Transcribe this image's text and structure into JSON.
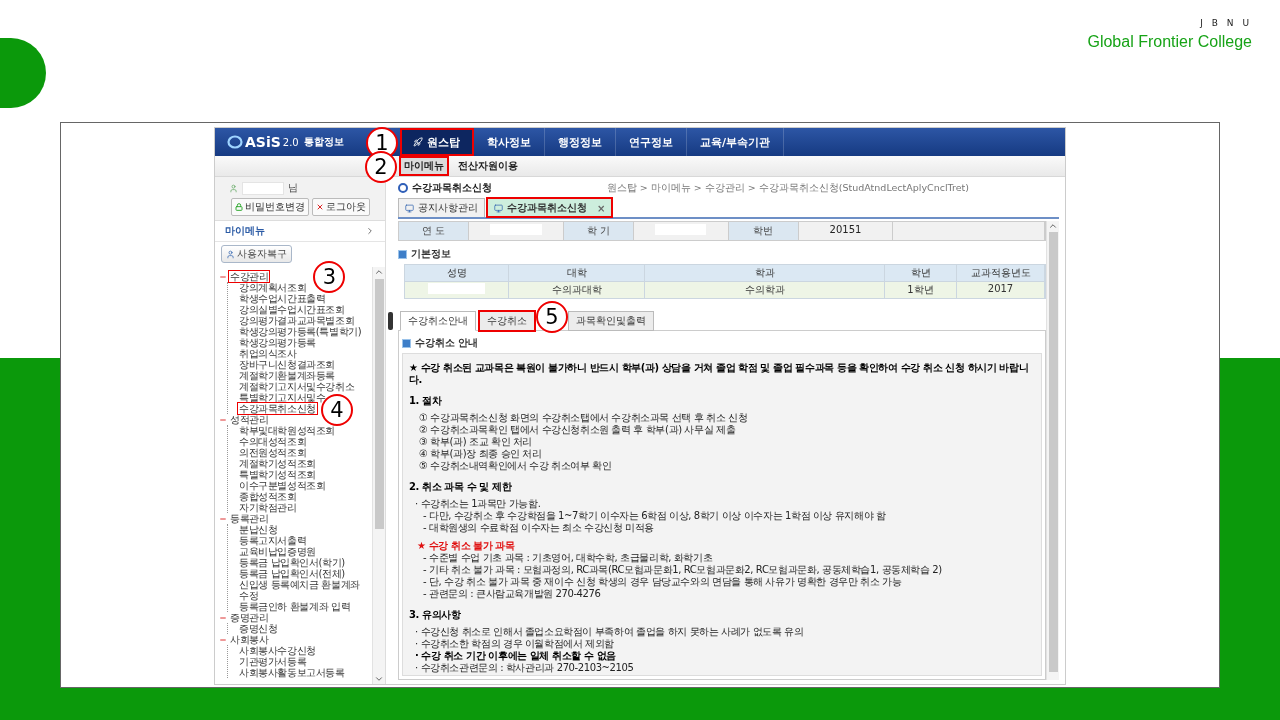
{
  "slide": {
    "org": "J B N U",
    "college": "Global Frontier College"
  },
  "app": {
    "logo": {
      "name": "ASiS",
      "version": "2.0",
      "title": "통합정보"
    },
    "top_nav": [
      {
        "label": "원스탑",
        "selected": true,
        "highlighted": true,
        "callout": "1"
      },
      {
        "label": "학사정보",
        "selected": false,
        "highlighted": false
      },
      {
        "label": "행정정보",
        "selected": false,
        "highlighted": false
      },
      {
        "label": "연구정보",
        "selected": false,
        "highlighted": false
      },
      {
        "label": "교육/부속기관",
        "selected": false,
        "highlighted": false
      }
    ],
    "sub_nav": [
      {
        "label": "마이메뉴",
        "selected": true,
        "highlighted": true,
        "callout": "2"
      },
      {
        "label": "전산자원이용",
        "selected": false,
        "highlighted": false
      }
    ],
    "user": {
      "suffix": "님",
      "buttons": [
        {
          "kind": "password",
          "label": "비밀번호변경"
        },
        {
          "kind": "logout",
          "label": "로그아웃"
        }
      ]
    },
    "my_menu": "마이메뉴",
    "restore_button": "사용자복구",
    "tree": [
      {
        "label": "수강관리",
        "expanded": true,
        "highlighted": true,
        "callout": "3",
        "children": [
          {
            "label": "강의계획서조회",
            "highlighted": false
          },
          {
            "label": "학생수업시간표출력",
            "highlighted": false
          },
          {
            "label": "강의실별수업시간표조회",
            "highlighted": false
          },
          {
            "label": "강의평가결과교과목별조회",
            "highlighted": false
          },
          {
            "label": "학생강의평가등록(특별학기)",
            "highlighted": false
          },
          {
            "label": "학생강의평가등록",
            "highlighted": false
          },
          {
            "label": "취업의식조사",
            "highlighted": false
          },
          {
            "label": "장바구니신청결과조회",
            "highlighted": false
          },
          {
            "label": "계절학기환불계좌등록",
            "highlighted": false
          },
          {
            "label": "계절학기고지서및수강취소",
            "highlighted": false
          },
          {
            "label": "특별학기고지서및수",
            "highlighted": false
          },
          {
            "label": "수강과목취소신청",
            "highlighted": true,
            "callout": "4"
          }
        ]
      },
      {
        "label": "성적관리",
        "expanded": true,
        "highlighted": false,
        "children": [
          {
            "label": "학부및대학원성적조회",
            "highlighted": false
          },
          {
            "label": "수의대성적조회",
            "highlighted": false
          },
          {
            "label": "의전원성적조회",
            "highlighted": false
          },
          {
            "label": "계절학기성적조회",
            "highlighted": false
          },
          {
            "label": "특별학기성적조회",
            "highlighted": false
          },
          {
            "label": "이수구분별성적조회",
            "highlighted": false
          },
          {
            "label": "종합성적조회",
            "highlighted": false
          },
          {
            "label": "자기학점관리",
            "highlighted": false
          }
        ]
      },
      {
        "label": "등록관리",
        "expanded": true,
        "highlighted": false,
        "children": [
          {
            "label": "분납신청",
            "highlighted": false
          },
          {
            "label": "등록고지서출력",
            "highlighted": false
          },
          {
            "label": "교육비납입증명원",
            "highlighted": false
          },
          {
            "label": "등록금 납입확인서(학기)",
            "highlighted": false
          },
          {
            "label": "등록금 납입확인서(전체)",
            "highlighted": false
          },
          {
            "label": "신입생 등록예치금 환불계좌 수정",
            "highlighted": false
          },
          {
            "label": "등록금인하 환불계좌 입력",
            "highlighted": false
          }
        ]
      },
      {
        "label": "증명관리",
        "expanded": true,
        "highlighted": false,
        "children": [
          {
            "label": "증명신청",
            "highlighted": false
          }
        ]
      },
      {
        "label": "사회봉사",
        "expanded": true,
        "highlighted": false,
        "children": [
          {
            "label": "사회봉사수강신청",
            "highlighted": false
          },
          {
            "label": "기관평가서등록",
            "highlighted": false
          },
          {
            "label": "사회봉사활동보고서등록",
            "highlighted": false
          }
        ]
      }
    ],
    "page": {
      "title": "수강과목취소신청",
      "breadcrumb": "원스탑 > 마이메뉴 > 수강관리 > 수강과목취소신청(StudAtndLectAplyCnclTret)",
      "doc_tabs": [
        {
          "label": "공지사항관리",
          "selected": false,
          "highlighted": false
        },
        {
          "label": "수강과목취소신청",
          "selected": true,
          "highlighted": true,
          "close": "×"
        }
      ],
      "term_row": [
        {
          "label": "연 도"
        },
        {
          "label": "학 기"
        },
        {
          "label": "학번",
          "value": "20151"
        }
      ],
      "basic_info": {
        "title": "기본정보",
        "columns": [
          "성명",
          "대학",
          "학과",
          "학년",
          "교과적용년도"
        ],
        "row": [
          "수의과대학",
          "수의학과",
          "1학년",
          "2017"
        ]
      },
      "inner_tabs": [
        {
          "label": "수강취소안내",
          "selected": true,
          "highlighted": false
        },
        {
          "label": "수강취소",
          "selected": false,
          "highlighted": true,
          "callout": "5"
        },
        {
          "label": "과목확인및출력",
          "selected": false,
          "highlighted": false
        }
      ],
      "guide": {
        "title": "수강취소 안내",
        "blocks": [
          {
            "kind": "notice",
            "text": "★ 수강 취소된 교과목은 복원이 불가하니 반드시 학부(과) 상담을 거쳐 졸업 학점 및 졸업 필수과목 등을 확인하여 수강 취소 신청 하시기 바랍니다."
          },
          {
            "kind": "heading",
            "text": "1. 절차"
          },
          {
            "kind": "item",
            "text": "① 수강과목취소신청 화면의 수강취소탭에서 수강취소과목 선택 후 취소 신청"
          },
          {
            "kind": "item",
            "text": "② 수강취소과목확인 탭에서 수강신청취소원 출력 후 학부(과) 사무실 제출"
          },
          {
            "kind": "item",
            "text": "③ 학부(과) 조교 확인 처리"
          },
          {
            "kind": "item",
            "text": "④ 학부(과)장 최종 승인 처리"
          },
          {
            "kind": "item",
            "text": "⑤ 수강취소내역확인에서 수강 취소여부 확인"
          },
          {
            "kind": "heading",
            "text": "2. 취소 과목 수 및 제한"
          },
          {
            "kind": "bullet",
            "text": "· 수강취소는 1과목만 가능함."
          },
          {
            "kind": "sub",
            "text": "- 다만, 수강취소 후 수강학점을 1~7학기 이수자는 6학점 이상, 8학기 이상 이수자는 1학점 이상  유지해야 함"
          },
          {
            "kind": "sub",
            "text": "- 대학원생의 수료학점 이수자는 최소 수강신청 미적용"
          },
          {
            "kind": "alert",
            "text": "★ 수강 취소 불가 과목"
          },
          {
            "kind": "sub",
            "text": "- 수준별 수업 기초 과목 : 기초영어, 대학수학, 초급물리학, 화학기초"
          },
          {
            "kind": "sub",
            "text": "- 기타 취소 불가 과목 :   모험과정의, RC과목(RC모험과문화1, RC모험과문화2, RC모험과문화, 공동체학습1, 공동체학습 2)"
          },
          {
            "kind": "sub",
            "text": "- 단, 수강 취소 불가 과목 중 재이수 신청 학생의 경우 담당교수와의 면담을 통해 사유가 명확한 경우만 취소 가능"
          },
          {
            "kind": "sub",
            "text": "- 관련문의 : 큰사람교육개발원 270-4276"
          },
          {
            "kind": "heading",
            "text": "3. 유의사항"
          },
          {
            "kind": "bullet",
            "text": "· 수강신청 취소로 인해서 졸업소요학점이 부족하여 졸업을 하지 못하는 사례가 없도록 유의"
          },
          {
            "kind": "bullet",
            "text": "· 수강취소한 학점의 경우 이월학점에서 제외함"
          },
          {
            "kind": "strong",
            "text": "· 수강 취소 기간 이후에는 일체 취소할 수 없음"
          },
          {
            "kind": "bullet",
            "text": "· 수강취소관련문의 : 학사관리과 270-2103~2105"
          }
        ]
      }
    }
  }
}
